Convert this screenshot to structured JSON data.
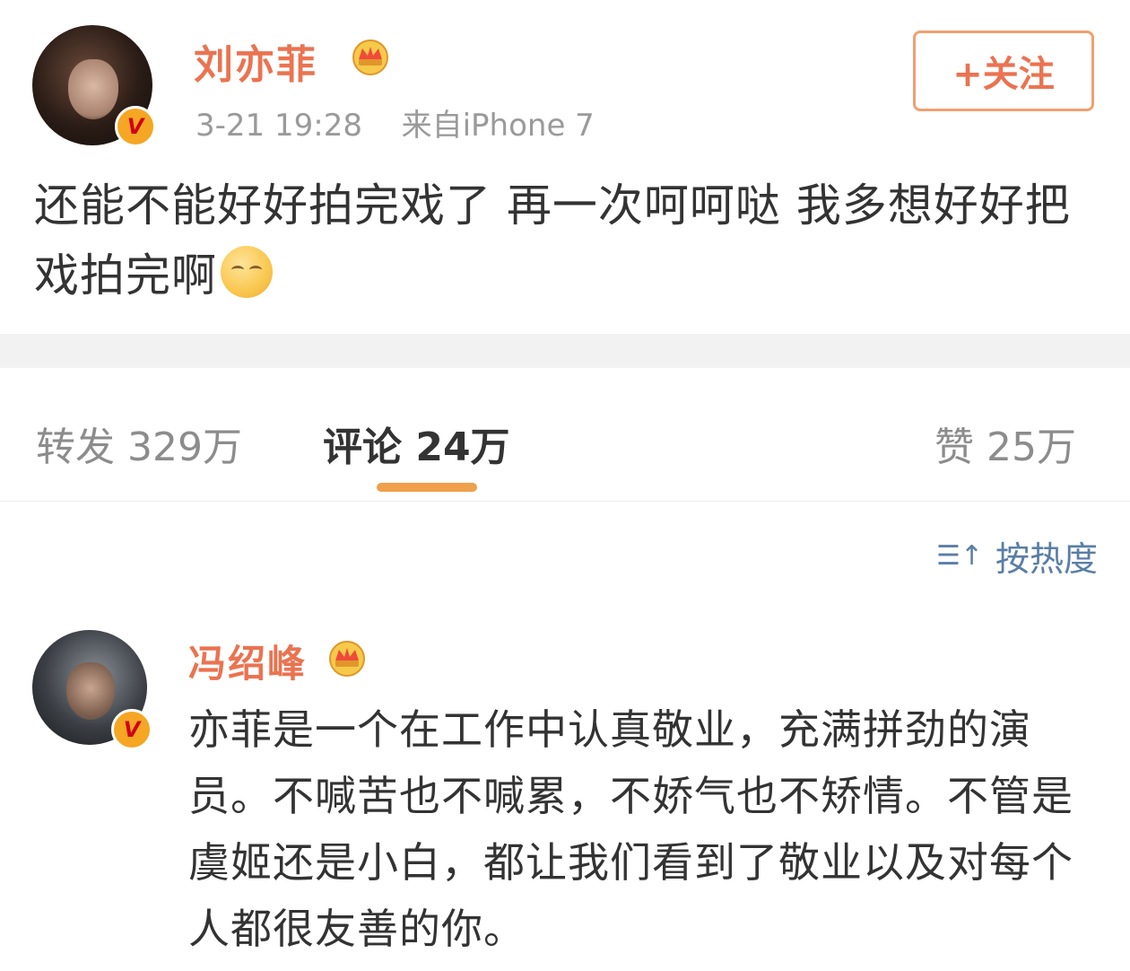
{
  "post": {
    "author": "刘亦菲",
    "verified_badge": "V",
    "timestamp": "3-21 19:28",
    "source_prefix": "来自",
    "source": "iPhone 7",
    "follow_label": "+关注",
    "text": "还能不能好好拍完戏了 再一次呵呵哒 我多想好好把戏拍完啊",
    "emoji": "smile-emoji"
  },
  "tabs": {
    "repost_label": "转发",
    "repost_count": "329万",
    "comment_label": "评论",
    "comment_count": "24万",
    "like_label": "赞",
    "like_count": "25万"
  },
  "sort": {
    "icon": "sort-hot-icon",
    "label": "按热度"
  },
  "comment": {
    "author": "冯绍峰",
    "verified_badge": "V",
    "text": "亦菲是一个在工作中认真敬业，充满拼劲的演员。不喊苦也不喊累，不娇气也不矫情。不管是虞姬还是小白，都让我们看到了敬业以及对每个人都很友善的你。"
  },
  "colors": {
    "username": "#eb7350",
    "accent": "#f0a04b",
    "link": "#5a7ea6",
    "separator": "#f2f2f2"
  }
}
